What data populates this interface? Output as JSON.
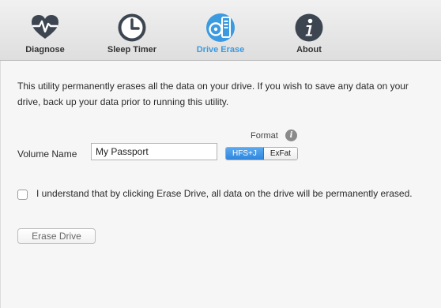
{
  "toolbar": {
    "tabs": [
      {
        "label": "Diagnose",
        "icon": "heart-pulse-icon"
      },
      {
        "label": "Sleep Timer",
        "icon": "clock-icon"
      },
      {
        "label": "Drive Erase",
        "icon": "drive-erase-icon"
      },
      {
        "label": "About",
        "icon": "info-icon"
      }
    ],
    "active_index": 2,
    "colors": {
      "active": "#3b9ae0",
      "icon": "#3d4650"
    }
  },
  "main": {
    "description": "This utility permanently erases all the data on your drive. If you wish to save any data on your drive, back up your data prior to running this utility.",
    "format_label": "Format",
    "format_info_glyph": "i",
    "volume_label": "Volume Name",
    "volume_value": "My Passport",
    "format_options": [
      "HFS+J",
      "ExFat"
    ],
    "format_selected": "HFS+J",
    "confirm_checked": false,
    "confirm_text": "I understand that by clicking Erase Drive, all data on the drive will be permanently erased.",
    "erase_button": "Erase Drive"
  }
}
